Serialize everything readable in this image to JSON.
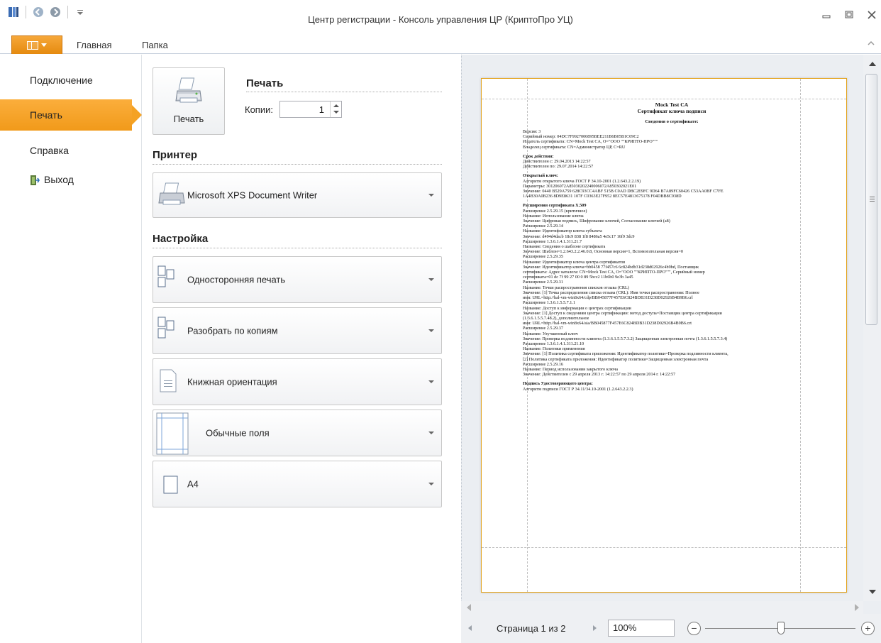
{
  "window": {
    "title": "Центр регистрации - Консоль управления ЦР (КриптоПро УЦ)",
    "controls": [
      "minimize-icon",
      "restore-icon",
      "close-icon"
    ]
  },
  "quick_access": [
    "app-icon",
    "back-icon",
    "forward-icon",
    "customize-icon"
  ],
  "ribbon": {
    "tabs": [
      {
        "label": "Главная"
      },
      {
        "label": "Папка"
      }
    ]
  },
  "backstage_nav": {
    "items": [
      {
        "label": "Подключение",
        "active": false
      },
      {
        "label": "Печать",
        "active": true
      },
      {
        "label": "Справка",
        "active": false
      },
      {
        "label": "Выход",
        "active": false,
        "icon": "exit-icon"
      }
    ]
  },
  "print_panel": {
    "print_button_label": "Печать",
    "heading": "Печать",
    "copies_label": "Копии:",
    "copies_value": "1",
    "printer_heading": "Принтер",
    "printer_name": "Microsoft XPS Document Writer",
    "settings_heading": "Настройка",
    "settings": [
      {
        "label": "Односторонняя печать",
        "icon": "one-sided-icon"
      },
      {
        "label": "Разобрать по копиям",
        "icon": "collate-icon"
      },
      {
        "label": "Книжная ориентация",
        "icon": "portrait-icon"
      },
      {
        "label": "Обычные поля",
        "icon": "margins-icon"
      },
      {
        "label": "A4",
        "icon": "paper-size-icon"
      }
    ]
  },
  "preview": {
    "doc": {
      "title1": "Mock Test CA",
      "title2": "Сертификат ключа подписи",
      "subtitle": "Сведения о сертификате:",
      "lines1": [
        "Версия:                3",
        "Серийный номер: 04DC7F9927000895BEE211B6B05B1C09C2",
        "Издатель сертификата:   CN=Mock Test CA, O=\"ООО \"\"КРИПТО-ПРО\"\"\"",
        "Владелец сертификата:   CN=Администратор ЦР, C=RU"
      ],
      "lines2": [
        "Срок действия:",
        "Действителен с:    29.04.2013  14:22:57",
        "Действителен по:  29.07.2014  14:22:57"
      ],
      "lines3": [
        "Открытый ключ:",
        "Алгоритм открытого ключа ГОСТ Р 34.10-2001 (1.2.643.2.2.19)",
        "Параметры: 301206072A85030202240006072A850302021E01",
        "Значение: 0440 B529A759 628C93CC4ABF 515B C0AD DBC2E9FC 9D64 B7A89FC60426 C53AA0BF C7FE",
        "1A4B30A0B236 8D9E8631 107F C0363E27F952 8EC57E4813675178 F04DBB8C938D"
      ],
      "lines4": [
        "Расширения сертификата X.509",
        "Расширение 2.5.29.15 (критичное)",
        "Название: Использование ключа",
        "Значение: Цифровая подпись, Шифрование ключей, Согласование ключей (a8)",
        "Расширение 2.5.29.14",
        "Название: Идентификатор ключа субъекта",
        "Значение: d494d4dacb 18c9 838 1f8 8486a5 4e5c17 16f9 3dc9",
        "Расширение 1.3.6.1.4.1.311.21.7",
        "Название: Сведения о шаблоне сертификата",
        "Значение: Шаблон=1.2.643.2.2.46.0.8, Основная версия=1, Вспомогательная версия=0",
        "Расширение 2.5.29.35",
        "Название: Идентификатор ключа центра сертификатов",
        "Значение: Идентификатор ключа=bb0458 77f457c6 6c824bdb31d238d02926c4b9bd, Поставщик",
        "сертификата: Адрес каталога: CN=Mock Test CA, O=\"ООО \"\"КРИПТО-ПРО\"\"\", Серийный номер",
        "сертификата=01 dc 7f 99 27 00 0 89 5bcc2 11b6b0 9e3b 3a45",
        "Расширение 2.5.29.31",
        "Название: Точки распространения списков отзыва (CRL)",
        "Значение: [1] Точка распределения списка отзыва (CRL): Имя точки распространения: Полное",
        "имя: URL=http://hal-vm-win8x64/cdp/BB045877F457E6C824BDB31D238D02926B4B9B6.crl",
        "Расширение 1.3.6.1.5.5.7.1.1",
        "Название: Доступ к информации о центрах сертификации",
        "Значение: [1] Доступ к сведениям центра сертификации: метод доступа=Поставщик центра сертификации",
        "(1.3.6.1.5.5.7.48.2), дополнительное",
        "имя: URL=http://hal-vm-win8x64/aia/BB045877F457E6C824BDB31D238D02926B4B9B6.crt",
        "Расширение 2.5.29.37",
        "Название: Улучшенный ключ",
        "Значение: Проверка подлинности клиента (1.3.6.1.5.5.7.3.2) Защищенная электронная почта (1.3.6.1.5.5.7.3.4)",
        "Расширение 1.3.6.1.4.1.311.21.10",
        "Название: Политики применения",
        "Значение: [1] Политика сертификата приложения: Идентификатор политики=Проверка подлинности клиента,",
        "[2] Политика сертификата приложения: Идентификатор политики=Защищенная электронная почта",
        "Расширение 2.5.29.16",
        "Название: Период использования закрытого ключа",
        "Значение: Действителен с 29 апреля 2013 г. 14:22:57 по 29 апреля 2014 г. 14:22:57"
      ],
      "lines5": [
        "Подпись Удостоверяющего центра:",
        "Алгоритм подписи ГОСТ Р 34.11/34.10-2001 (1.2.643.2.2.3)"
      ]
    },
    "page_indicator": "Страница 1 из 2",
    "zoom_value": "100%",
    "zoom_percent": 100
  }
}
